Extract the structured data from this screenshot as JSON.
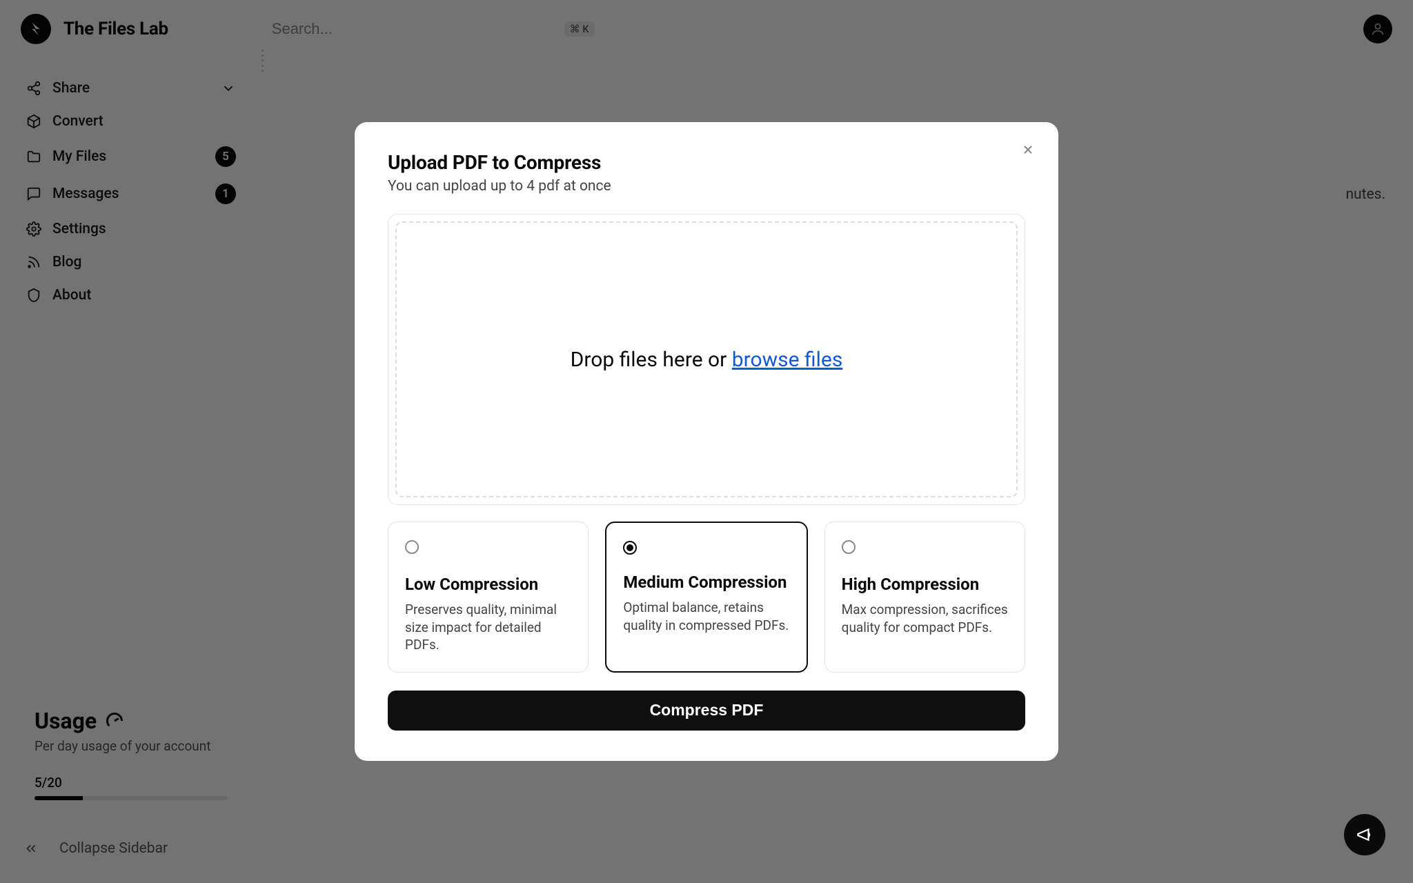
{
  "brand": "The Files Lab",
  "search": {
    "placeholder": "Search...",
    "shortcut": "⌘ K"
  },
  "sidebar": {
    "items": [
      {
        "label": "Share",
        "icon": "share-icon",
        "hasChevron": true
      },
      {
        "label": "Convert",
        "icon": "box-icon"
      },
      {
        "label": "My Files",
        "icon": "folder-icon",
        "badge": "5"
      },
      {
        "label": "Messages",
        "icon": "message-icon",
        "badge": "1"
      },
      {
        "label": "Settings",
        "icon": "gear-icon"
      },
      {
        "label": "Blog",
        "icon": "rss-icon"
      },
      {
        "label": "About",
        "icon": "shield-icon"
      }
    ],
    "usage": {
      "title": "Usage",
      "subtitle": "Per day usage of your account",
      "count_label": "5/20",
      "used": 5,
      "limit": 20
    },
    "collapse_label": "Collapse Sidebar"
  },
  "main_hint_suffix": "nutes.",
  "modal": {
    "title": "Upload PDF to Compress",
    "subtitle": "You can upload up to 4 pdf at once",
    "drop_text_prefix": "Drop files here or ",
    "drop_link": "browse files",
    "options": [
      {
        "title": "Low Compression",
        "desc": "Preserves quality, minimal size impact for detailed PDFs.",
        "selected": false
      },
      {
        "title": "Medium Compression",
        "desc": "Optimal balance, retains quality in compressed PDFs.",
        "selected": true
      },
      {
        "title": "High Compression",
        "desc": "Max compression, sacrifices quality for compact PDFs.",
        "selected": false
      }
    ],
    "submit_label": "Compress PDF"
  }
}
